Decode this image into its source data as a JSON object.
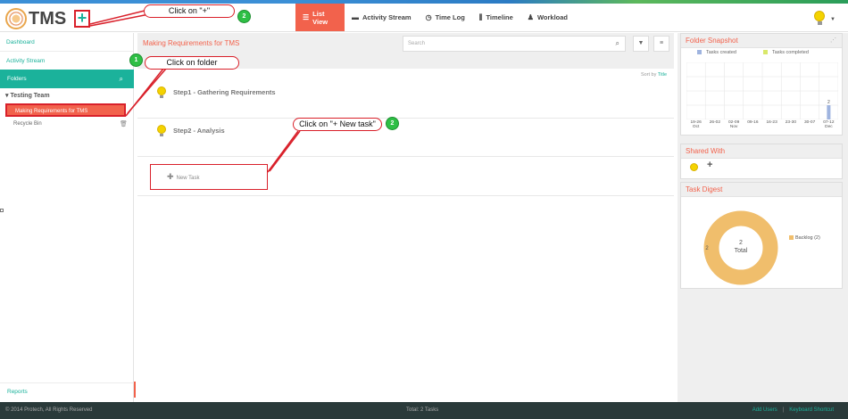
{
  "header": {
    "logo_text": "TMS",
    "add_label": "+",
    "nav": [
      {
        "label": "List View",
        "icon": "list-icon"
      },
      {
        "label": "Activity Stream",
        "icon": "comment-icon"
      },
      {
        "label": "Time Log",
        "icon": "clock-icon"
      },
      {
        "label": "Timeline",
        "icon": "bars-icon"
      },
      {
        "label": "Workload",
        "icon": "user-icon"
      }
    ]
  },
  "sidebar": {
    "dashboard": "Dashboard",
    "activity_stream": "Activity Stream",
    "folders_label": "Folders",
    "team": "Testing Team",
    "selected_folder": "Making Requirements for TMS",
    "recycle_bin": "Recycle Bin",
    "reports": "Reports"
  },
  "main": {
    "title": "Making Requirements for TMS",
    "search_placeholder": "Search",
    "sort_prefix": "Sort by",
    "sort_value": "Title",
    "tasks": [
      {
        "name": "Step1 - Gathering Requirements"
      },
      {
        "name": "Step2 - Analysis"
      }
    ],
    "new_task": "New Task"
  },
  "right": {
    "snapshot_title": "Folder Snapshot",
    "legend_created": "Tasks created",
    "legend_completed": "Tasks completed",
    "created_color": "#9fb4df",
    "completed_color": "#d9e86a",
    "shared_title": "Shared With",
    "digest_title": "Task Digest",
    "donut_center_value": "2",
    "donut_center_label": "Total",
    "donut_side_label": "2",
    "donut_legend": "Backlog (2)",
    "donut_color": "#f0be6c"
  },
  "chart_data": {
    "type": "bar",
    "categories": [
      "19-26 Oct",
      "26-02",
      "02-09 Nov",
      "09-16",
      "16-23",
      "23-30",
      "30-07",
      "07-12 Dec"
    ],
    "x_labels_top": [
      "19-26",
      "26-02",
      "02-09",
      "09-16",
      "16-23",
      "23-30",
      "30-07",
      "07-12"
    ],
    "x_labels_bottom": [
      "Oct",
      "",
      "Nov",
      "",
      "",
      "",
      "",
      "Dec"
    ],
    "series": [
      {
        "name": "Tasks created",
        "values": [
          0,
          0,
          0,
          0,
          0,
          0,
          0,
          2
        ]
      },
      {
        "name": "Tasks completed",
        "values": [
          0,
          0,
          0,
          0,
          0,
          0,
          0,
          0
        ]
      }
    ],
    "ylim": [
      0,
      8
    ],
    "data_labels": [
      "2"
    ]
  },
  "footer": {
    "copyright": "© 2014 Protech, All Rights Reserved",
    "total": "Total: 2 Tasks",
    "add_users": "Add Users",
    "separator": "|",
    "shortcut": "Keyboard Shortcut"
  },
  "annotations": {
    "callout_plus": "Click on \"+\"",
    "callout_folder": "Click on folder",
    "callout_newtask": "Click on \"+ New task\"",
    "badge_1": "1",
    "badge_2a": "2",
    "badge_2b": "2"
  }
}
